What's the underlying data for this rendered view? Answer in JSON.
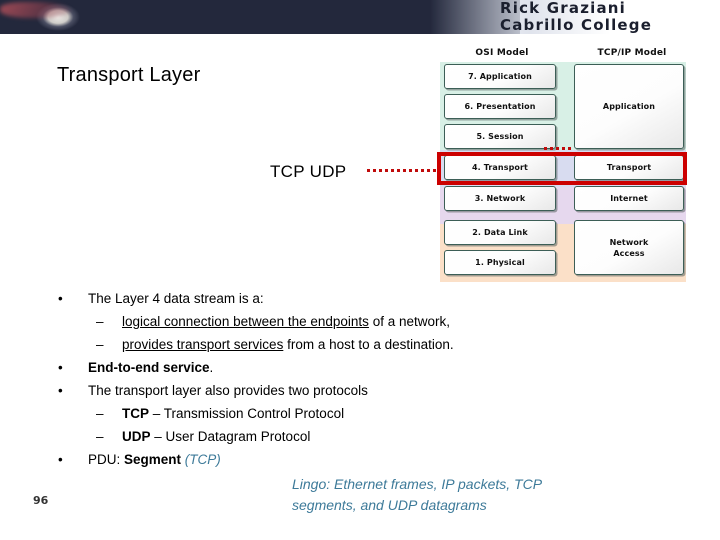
{
  "header": {
    "author_line1": "Rick Graziani",
    "author_line2": "Cabrillo College",
    "banner_icon": "network-cable-banner-image"
  },
  "slide": {
    "title": "Transport Layer",
    "page_number": "96"
  },
  "callout": {
    "label": "TCP UDP",
    "connector": "red-dotted-connector-line"
  },
  "diagram": {
    "osi_heading": "OSI Model",
    "tcpip_heading": "TCP/IP Model",
    "osi_layers": [
      {
        "label": "7. Application"
      },
      {
        "label": "6. Presentation"
      },
      {
        "label": "5. Session"
      },
      {
        "label": "4. Transport"
      },
      {
        "label": "3. Network"
      },
      {
        "label": "2. Data Link"
      },
      {
        "label": "1. Physical"
      }
    ],
    "tcpip_layers": [
      {
        "label": "Application"
      },
      {
        "label": "Transport"
      },
      {
        "label": "Internet"
      },
      {
        "label": "Network\nAccess"
      }
    ],
    "highlight": {
      "name": "transport-layer-highlight",
      "color": "#cc0000"
    },
    "band_colors": {
      "application": "#d8f0e6",
      "transport": "#d8dcf0",
      "network": "#e6d8ee",
      "access": "#fbe0c8"
    }
  },
  "body": {
    "b1_mark": "•",
    "b1_text": "The Layer 4 data stream is a:",
    "b1s1_mark": "–",
    "b1s1_underlined": "logical connection between the endpoints",
    "b1s1_rest": " of a network,",
    "b1s2_mark": "–",
    "b1s2_underlined": "provides transport services",
    "b1s2_rest": " from a host to a destination.",
    "b2_mark": "•",
    "b2_bold": "End-to-end service",
    "b2_rest": ".",
    "b3_mark": "•",
    "b3_text": "The transport layer also provides two protocols",
    "b3s1_mark": "–",
    "b3s1_bold": "TCP",
    "b3s1_rest": " – Transmission Control Protocol",
    "b3s2_mark": "–",
    "b3s2_bold": "UDP",
    "b3s2_rest": " – User Datagram Protocol",
    "b4_mark": "•",
    "b4_prefix": "PDU: ",
    "b4_bold": "Segment",
    "b4_italic": " (TCP)"
  },
  "lingo": {
    "line1": "Lingo:  Ethernet frames, IP packets, TCP",
    "line2": "segments, and UDP datagrams",
    "color": "#3d7a99"
  }
}
